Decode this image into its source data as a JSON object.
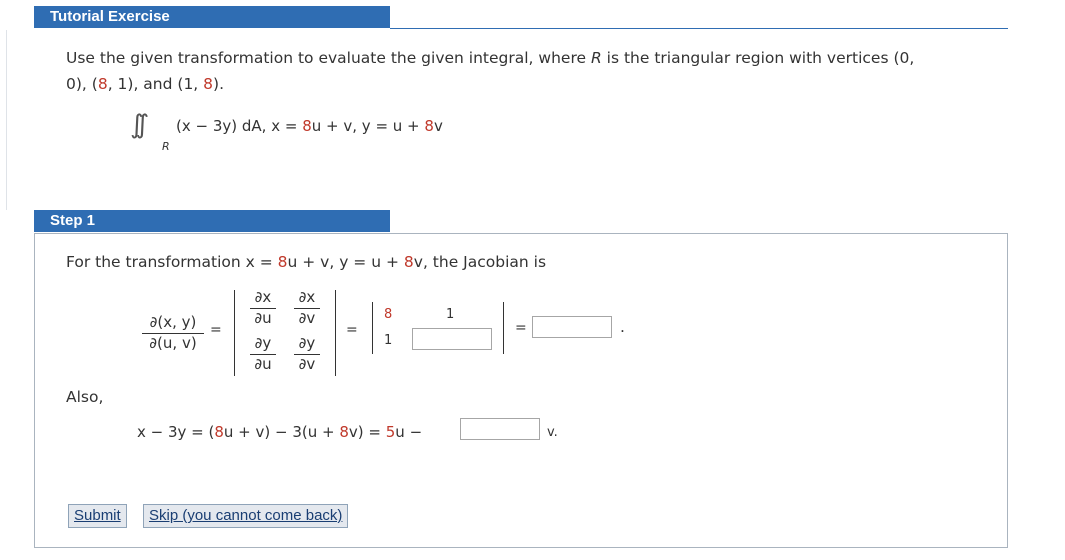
{
  "header": {
    "title": "Tutorial Exercise"
  },
  "problem": {
    "text_start": "Use the given transformation to evaluate the given integral, where ",
    "R": "R",
    "text_mid": " is the triangular region with vertices (0,",
    "line2_a": "0), (",
    "v8": "8",
    "line2_b": ", 1), and (1, ",
    "v8b": "8",
    "line2_c": ").",
    "integral_sign": "∫∫",
    "integral_sub": "R",
    "integrand": "(x − 3y) dA,",
    "x_eq": "x = ",
    "x_coef": "8",
    "x_rest": "u + v,",
    "y_eq": "y = u + ",
    "y_coef": "8",
    "y_rest": "v"
  },
  "step1": {
    "header": "Step 1",
    "intro_a": "For the transformation ",
    "intro_x": "x = ",
    "intro_x_coef": "8",
    "intro_x_rest": "u + v,",
    "intro_y": " y = u + ",
    "intro_y_coef": "8",
    "intro_y_rest": "v,",
    "intro_b": " the Jacobian is",
    "jac_num": "∂(x, y)",
    "jac_den": "∂(u, v)",
    "eq": "=",
    "dx": "∂x",
    "dy": "∂y",
    "du": "∂u",
    "dv": "∂v",
    "m11": "8",
    "m12": "1",
    "m21": "1",
    "period": ".",
    "also": "Also,",
    "line_a": "x − 3y = (",
    "line_coef1": "8",
    "line_b": "u + v) − 3(u + ",
    "line_coef2": "8",
    "line_c": "v) = ",
    "line_coef3": "5",
    "line_d": "u −",
    "line_end": "v.",
    "submit": "Submit",
    "skip": "Skip (you cannot come back)"
  },
  "colors": {
    "header_bg": "#2f6db3",
    "red": "#c0392b",
    "border": "#aab4bf"
  }
}
